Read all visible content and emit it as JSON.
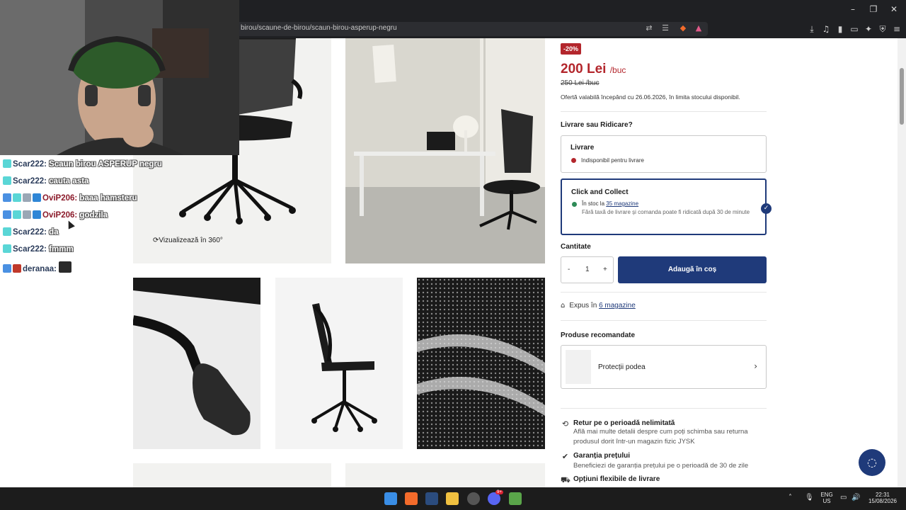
{
  "browser": {
    "url": "birou/scaune-de-birou/scaun-birou-asperup-negru",
    "window_controls": [
      "–",
      "❐",
      "✕"
    ]
  },
  "product": {
    "discount_badge": "-20%",
    "price": "200 Lei",
    "price_unit": "/buc",
    "old_price": "250 Lei /buc",
    "offer_note": "Ofertă valabilă începând cu 26.06.2026, în limita stocului disponibil.",
    "view_360_label": "Vizualizează în 360°"
  },
  "delivery": {
    "heading": "Livrare sau Ridicare?",
    "livrare": {
      "title": "Livrare",
      "status": "Indisponibil pentru livrare",
      "status_color": "#b3262c"
    },
    "click_collect": {
      "title": "Click and Collect",
      "status_prefix": "În stoc la ",
      "status_link": "35 magazine",
      "status_color": "#2e8b57",
      "description": "Fără taxă de livrare și comanda poate fi ridicată după 30 de minute"
    }
  },
  "quantity": {
    "heading": "Cantitate",
    "minus": "-",
    "value": "1",
    "plus": "+",
    "add_to_cart": "Adaugă în coș"
  },
  "exposure": {
    "prefix": "Expus în ",
    "link": "6 magazine"
  },
  "recommended": {
    "heading": "Produse recomandate",
    "item_label": "Protecții podea"
  },
  "features": [
    {
      "title": "Retur pe o perioadă nelimitată",
      "desc": "Află mai multe detalii despre cum poți schimba sau returna produsul dorit într-un magazin fizic JYSK",
      "icon": "return-icon"
    },
    {
      "title": "Garanția prețului",
      "desc": "Beneficiezi de garanția prețului pe o perioadă de 30 de zile",
      "icon": "badge-check-icon"
    },
    {
      "title": "Opțiuni flexibile de livrare",
      "desc": "",
      "icon": "truck-icon"
    }
  ],
  "stream_chat": [
    {
      "user": "Scar222:",
      "msg": " Scaun birou ASPERUP negru",
      "user_color": "blue"
    },
    {
      "user": "Scar222:",
      "msg": " cauta asta",
      "user_color": "blue"
    },
    {
      "user": "OviP206:",
      "msg": " baaa hamsteru",
      "user_color": "red"
    },
    {
      "user": "OviP206:",
      "msg": " godzila",
      "user_color": "red"
    },
    {
      "user": "Scar222:",
      "msg": " da",
      "user_color": "blue"
    },
    {
      "user": "Scar222:",
      "msg": " fmmm",
      "user_color": "blue"
    },
    {
      "user": "deranaa:",
      "msg": "",
      "user_color": "blue"
    }
  ],
  "taskbar": {
    "language_top": "ENG",
    "language_bottom": "US",
    "time": "22:31",
    "date": "15/08/2026",
    "discord_badge": "9+"
  }
}
